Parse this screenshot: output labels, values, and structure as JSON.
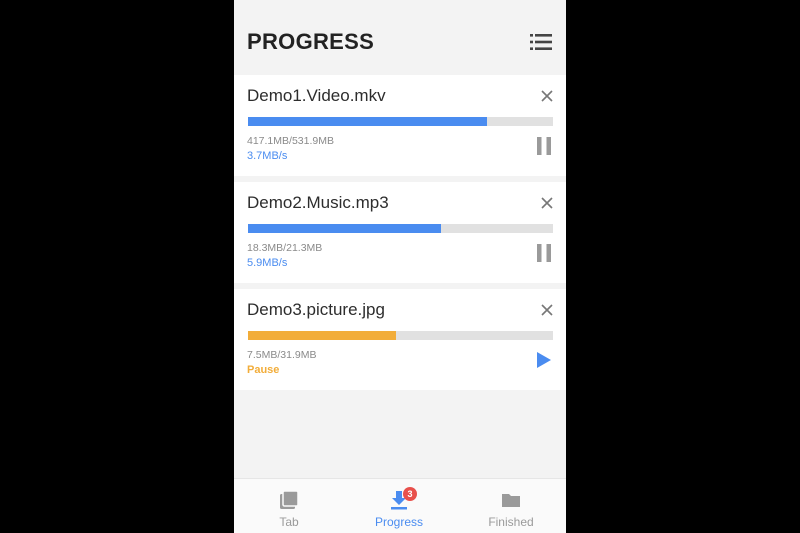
{
  "header": {
    "title": "PROGRESS",
    "menu_icon": "list-menu-icon"
  },
  "downloads": [
    {
      "name": "Demo1.Video.mkv",
      "size": "417.1MB/531.9MB",
      "status": "3.7MB/s",
      "progress": 0.784,
      "state": "downloading",
      "color": "#4a8cf0",
      "action_icon": "pause-icon"
    },
    {
      "name": "Demo2.Music.mp3",
      "size": "18.3MB/21.3MB",
      "status": "5.9MB/s",
      "progress": 0.633,
      "state": "downloading",
      "color": "#4a8cf0",
      "action_icon": "pause-icon"
    },
    {
      "name": "Demo3.picture.jpg",
      "size": "7.5MB/31.9MB",
      "status": "Pause",
      "progress": 0.484,
      "state": "paused",
      "color": "#f2ad3a",
      "action_icon": "play-icon"
    }
  ],
  "tabs": [
    {
      "label": "Tab",
      "icon": "tabs-icon",
      "active": false
    },
    {
      "label": "Progress",
      "icon": "download-icon",
      "active": true,
      "badge": "3"
    },
    {
      "label": "Finished",
      "icon": "folder-icon",
      "active": false
    }
  ],
  "colors": {
    "accent": "#4a8cf0",
    "paused": "#f2ad3a",
    "inactive": "#9a9a9a",
    "badge": "#e8504b"
  }
}
